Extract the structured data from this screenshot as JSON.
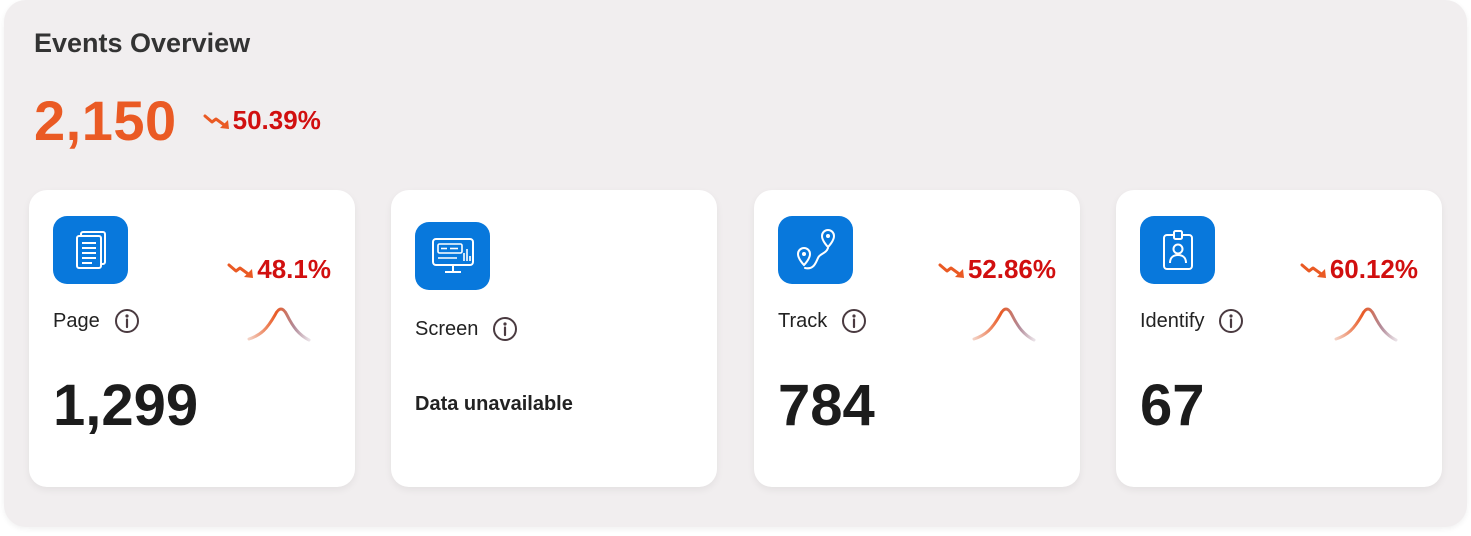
{
  "header": {
    "title": "Events Overview",
    "total": "2,150",
    "total_change": "50.39%"
  },
  "colors": {
    "accent_total": "#ea5a24",
    "decline_red": "#d10f0f",
    "trend_arrow": "#ea5a24",
    "icon_bg": "#0878dc"
  },
  "cards": [
    {
      "label": "Page",
      "change": "48.1%",
      "value": "1,299",
      "icon": "document-icon"
    },
    {
      "label": "Screen",
      "unavailable": "Data unavailable",
      "icon": "monitor-icon"
    },
    {
      "label": "Track",
      "change": "52.86%",
      "value": "784",
      "icon": "route-icon"
    },
    {
      "label": "Identify",
      "change": "60.12%",
      "value": "67",
      "icon": "id-badge-icon"
    }
  ]
}
